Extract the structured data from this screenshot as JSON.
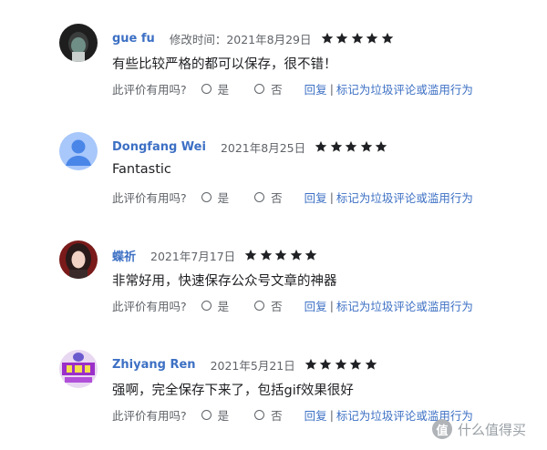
{
  "colors": {
    "accent_link": "#3d70c4",
    "star": "#202124",
    "muted": "#5f6368"
  },
  "reviews": [
    {
      "author": "gue fu",
      "date": "修改时间：2021年8月29日",
      "rating": 5,
      "text": "有些比较严格的都可以保存，很不错！",
      "helpful_question": "此评价有用吗?",
      "yes_label": "是",
      "no_label": "否",
      "reply_label": "回复",
      "separator": "|",
      "report_label": "标记为垃圾评论或滥用行为",
      "avatar_icon": "user-photo-icon"
    },
    {
      "author": "Dongfang Wei",
      "date": "2021年8月25日",
      "rating": 5,
      "text": "Fantastic",
      "helpful_question": "此评价有用吗?",
      "yes_label": "是",
      "no_label": "否",
      "reply_label": "回复",
      "separator": "|",
      "report_label": "标记为垃圾评论或滥用行为",
      "avatar_icon": "default-person-icon"
    },
    {
      "author": "蝶祈",
      "date": "2021年7月17日",
      "rating": 5,
      "text": "非常好用，快速保存公众号文章的神器",
      "helpful_question": "此评价有用吗?",
      "yes_label": "是",
      "no_label": "否",
      "reply_label": "回复",
      "separator": "|",
      "report_label": "标记为垃圾评论或滥用行为",
      "avatar_icon": "user-photo-icon"
    },
    {
      "author": "Zhiyang Ren",
      "date": "2021年5月21日",
      "rating": 5,
      "text": "强啊，完全保存下来了，包括gif效果很好",
      "helpful_question": "此评价有用吗?",
      "yes_label": "是",
      "no_label": "否",
      "reply_label": "回复",
      "separator": "|",
      "report_label": "标记为垃圾评论或滥用行为",
      "avatar_icon": "user-photo-icon"
    }
  ],
  "watermark": {
    "logo_text": "值",
    "text": "什么值得买"
  }
}
